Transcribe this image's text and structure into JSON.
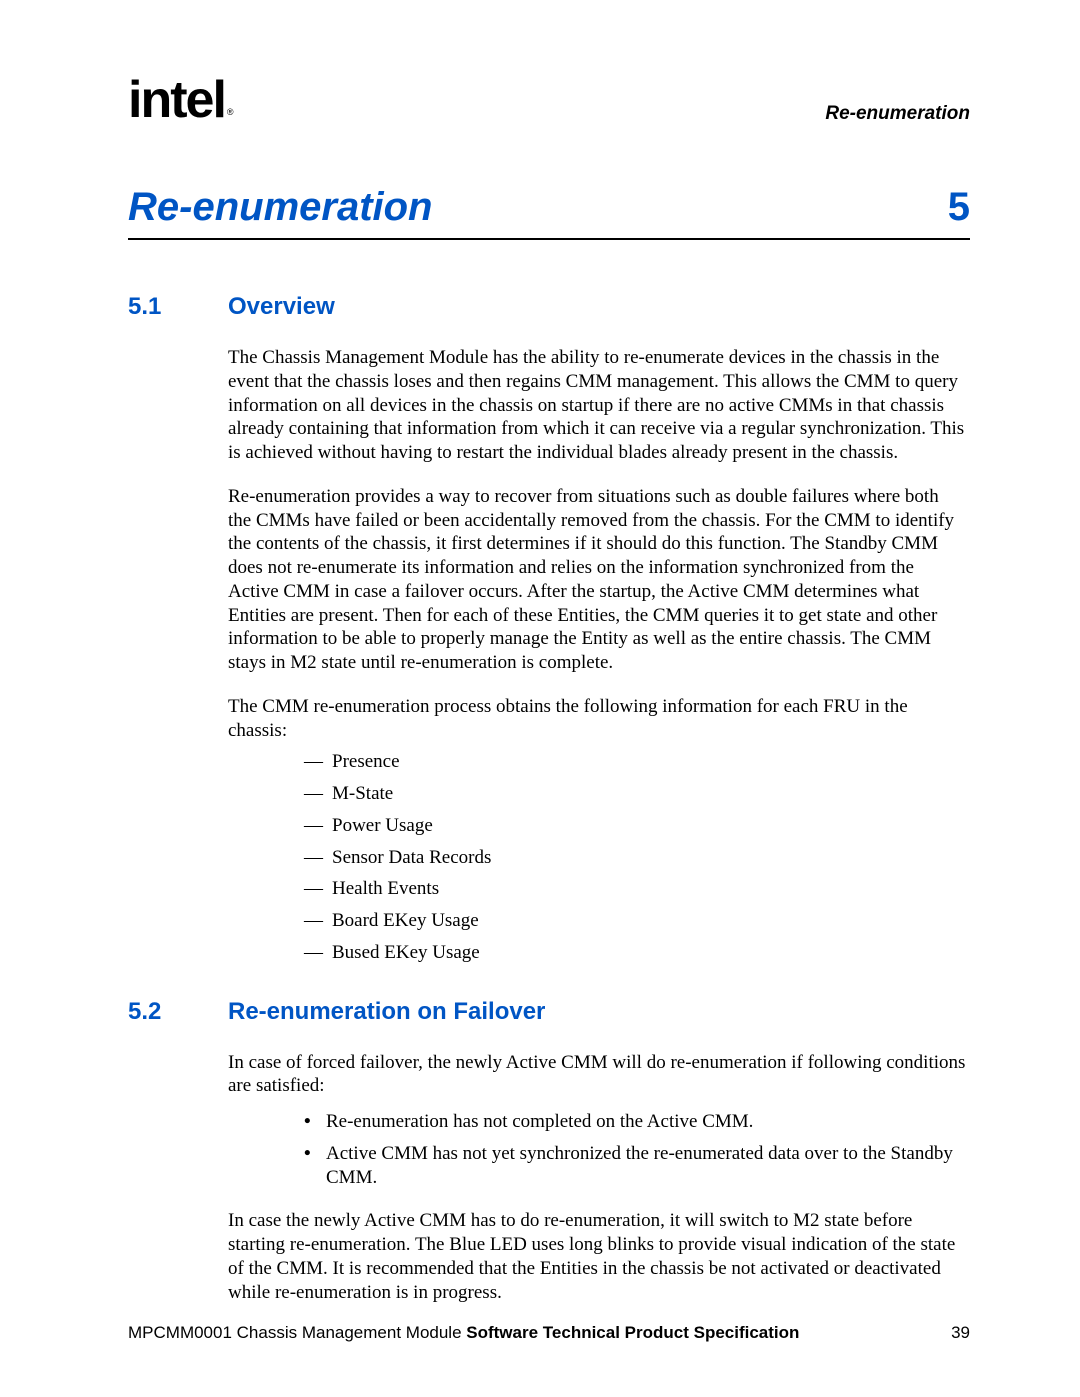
{
  "header": {
    "logo_text": "intel",
    "logo_symbol": "®",
    "section_tag": "Re-enumeration"
  },
  "chapter": {
    "title": "Re-enumeration",
    "number": "5"
  },
  "sections": {
    "s51": {
      "num": "5.1",
      "title": "Overview"
    },
    "s52": {
      "num": "5.2",
      "title": "Re-enumeration on Failover"
    }
  },
  "body": {
    "p1": "The Chassis Management Module has the ability to re-enumerate devices in the chassis in the event that the chassis loses and then regains CMM management. This allows the CMM to query information on all devices in the chassis on startup if there are no active CMMs in that chassis already containing that information from which it can receive via a regular synchronization. This is achieved without having to restart the individual blades already present in the chassis.",
    "p2": "Re-enumeration provides a way to recover from situations such as double failures where both the CMMs have failed or been accidentally removed from the chassis. For the CMM to identify the contents of the chassis, it first determines if it should do this function. The Standby CMM does not re-enumerate its information and relies on the information synchronized from the Active CMM in case a failover occurs. After the startup, the Active CMM determines what Entities are present. Then for each of these Entities, the CMM queries it to get state and other information to be able to properly manage the Entity as well as the entire chassis. The CMM stays in M2 state until re-enumeration is complete.",
    "p3": "The CMM re-enumeration process obtains the following information for each FRU in the chassis:",
    "list1": [
      "Presence",
      "M-State",
      "Power Usage",
      "Sensor Data Records",
      "Health Events",
      "Board EKey Usage",
      "Bused EKey Usage"
    ],
    "p4": "In case of forced failover, the newly Active CMM will do re-enumeration if following conditions are satisfied:",
    "list2": [
      "Re-enumeration has not completed on the Active CMM.",
      "Active CMM has not yet synchronized the re-enumerated data over to the Standby CMM."
    ],
    "p5": "In case the newly Active CMM has to do re-enumeration, it will switch to M2 state before starting re-enumeration. The Blue LED uses long blinks to provide visual indication of the state of the CMM. It is recommended that the Entities in the chassis be not activated or deactivated while re-enumeration is in progress."
  },
  "footer": {
    "doc_left_plain": "MPCMM0001 Chassis Management Module ",
    "doc_left_bold": "Software Technical Product Specification",
    "page_num": "39"
  }
}
